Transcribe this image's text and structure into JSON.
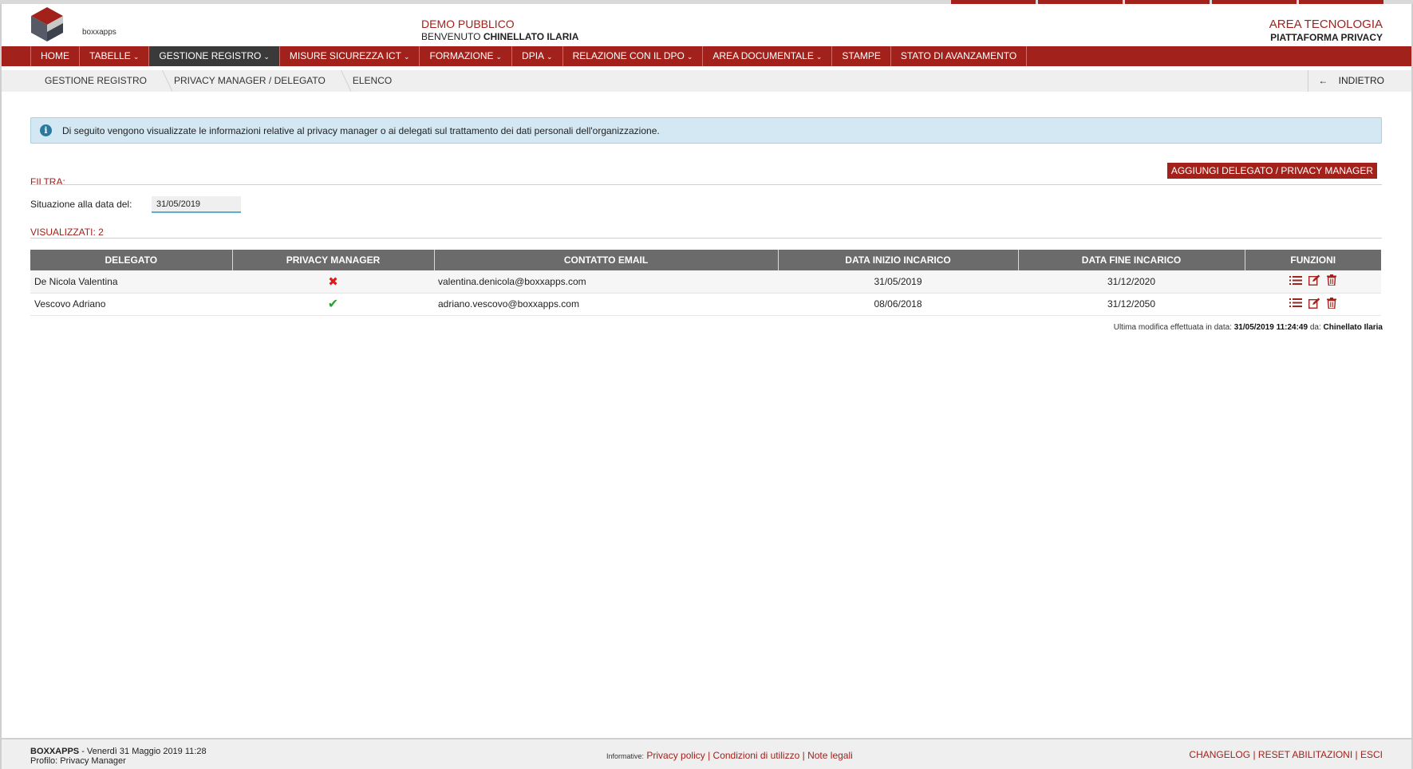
{
  "brand": {
    "logo_text": "boxxapps"
  },
  "header": {
    "app_name": "DEMO PUBBLICO",
    "welcome_prefix": "BENVENUTO",
    "user_name": "CHINELLATO ILARIA",
    "area": "AREA TECNOLOGIA",
    "platform": "PIATTAFORMA PRIVACY"
  },
  "nav": {
    "items": [
      {
        "label": "HOME",
        "caret": ""
      },
      {
        "label": "TABELLE",
        "caret": "⌄"
      },
      {
        "label": "GESTIONE REGISTRO",
        "caret": "⌄"
      },
      {
        "label": "MISURE SICUREZZA ICT",
        "caret": "⌄"
      },
      {
        "label": "FORMAZIONE",
        "caret": "⌄"
      },
      {
        "label": "DPIA",
        "caret": "⌄"
      },
      {
        "label": "RELAZIONE CON IL DPO",
        "caret": "⌄"
      },
      {
        "label": "AREA DOCUMENTALE",
        "caret": "⌄"
      },
      {
        "label": "STAMPE",
        "caret": ""
      },
      {
        "label": "STATO DI AVANZAMENTO",
        "caret": ""
      }
    ]
  },
  "breadcrumb": {
    "items": [
      "GESTIONE REGISTRO",
      "PRIVACY MANAGER / DELEGATO",
      "ELENCO"
    ],
    "back_label": "INDIETRO"
  },
  "alert": {
    "icon": "i",
    "text": "Di seguito vengono visualizzate le informazioni relative al privacy manager o ai delegati sul trattamento dei dati personali dell'organizzazione."
  },
  "filter": {
    "title": "FILTRA:",
    "add_button": "AGGIUNGI DELEGATO / PRIVACY MANAGER",
    "date_label": "Situazione alla data del:",
    "date_value": "31/05/2019"
  },
  "results": {
    "title": "VISUALIZZATI: 2",
    "columns": [
      "DELEGATO",
      "PRIVACY MANAGER",
      "CONTATTO EMAIL",
      "DATA INIZIO INCARICO",
      "DATA FINE INCARICO",
      "FUNZIONI"
    ],
    "rows": [
      {
        "delegato": "De Nicola Valentina",
        "pm_mark": "✖",
        "email": "valentina.denicola@boxxapps.com",
        "inizio": "31/05/2019",
        "fine": "31/12/2020"
      },
      {
        "delegato": "Vescovo Adriano",
        "pm_mark": "✔",
        "email": "adriano.vescovo@boxxapps.com",
        "inizio": "08/06/2018",
        "fine": "31/12/2050"
      }
    ],
    "last_mod_prefix": "Ultima modifica effettuata in data:",
    "last_mod_date": "31/05/2019 11:24:49",
    "last_mod_by_prefix": "da:",
    "last_mod_by": "Chinellato Ilaria"
  },
  "footer": {
    "company": "BOXXAPPS",
    "datetime": "- Venerdì 31 Maggio 2019 11:28",
    "profile": "Profilo: Privacy Manager",
    "info_label": "Informative:",
    "privacy_link": "Privacy policy",
    "conditions_link": "Condizioni di utilizzo",
    "legal_link": "Note legali",
    "changelog_link": "CHANGELOG",
    "reset_link": "RESET ABILITAZIONI",
    "exit_link": "ESCI",
    "sep": "|"
  },
  "colors": {
    "accent": "#a3211b",
    "nav_active": "#3a3a3a",
    "table_header": "#6b6b6b",
    "alert_bg": "#d3e8f2",
    "ok": "#2ea02e",
    "ko": "#e01b1b"
  }
}
